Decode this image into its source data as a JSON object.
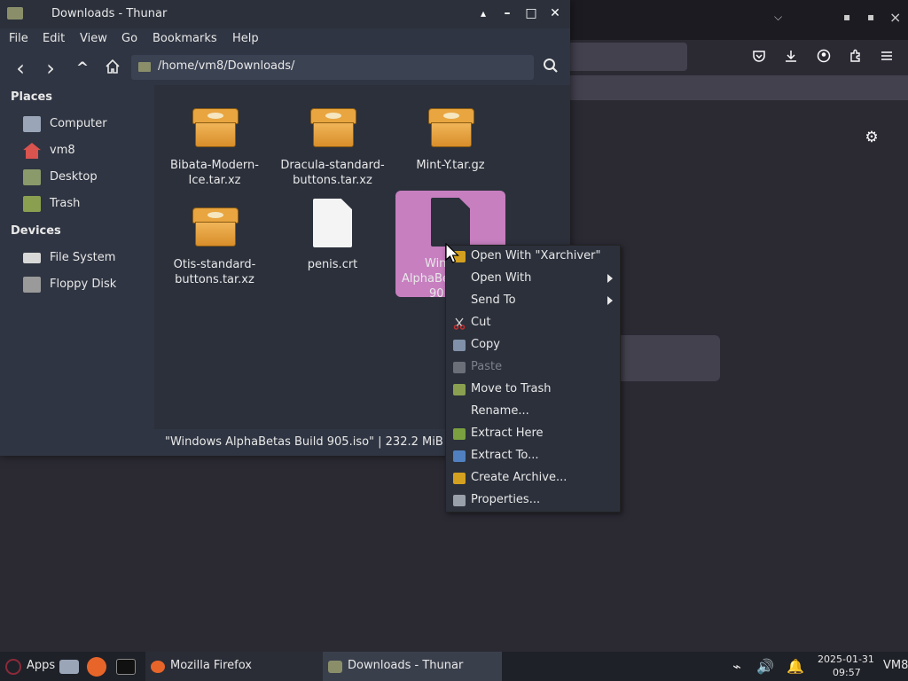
{
  "firefox": {
    "window_controls": {
      "chevron": "⌵",
      "minimize": "▪",
      "maximize": "▪",
      "close": "×"
    },
    "toolbar_icons": [
      "pocket-icon",
      "download-icon",
      "account-icon",
      "extensions-icon",
      "menu-icon"
    ],
    "gear": "⚙"
  },
  "thunar": {
    "title": "Downloads - Thunar",
    "window_controls": {
      "shade": "▴",
      "minimize": "–",
      "maximize": "□",
      "close": "✕"
    },
    "menu": [
      "File",
      "Edit",
      "View",
      "Go",
      "Bookmarks",
      "Help"
    ],
    "nav": {
      "back": "‹",
      "forward": "›",
      "up": "^",
      "home": "⌂"
    },
    "path": "/home/vm8/Downloads/",
    "search_glyph": "⌕",
    "sidebar": {
      "places_header": "Places",
      "places": [
        {
          "label": "Computer",
          "icon": "computer-icon",
          "color": "#9aa6b8"
        },
        {
          "label": "vm8",
          "icon": "home-icon",
          "color": "#d9534f"
        },
        {
          "label": "Desktop",
          "icon": "desktop-icon",
          "color": "#8a9a6a"
        },
        {
          "label": "Trash",
          "icon": "trash-icon",
          "color": "#8aa050"
        }
      ],
      "devices_header": "Devices",
      "devices": [
        {
          "label": "File System",
          "icon": "drive-icon",
          "color": "#d8d8d8"
        },
        {
          "label": "Floppy Disk",
          "icon": "floppy-icon",
          "color": "#9a9a9a"
        }
      ]
    },
    "files": [
      {
        "name_line1": "Bibata-Modern-",
        "name_line2": "Ice.tar.xz",
        "type": "archive"
      },
      {
        "name_line1": "Dracula-standard-",
        "name_line2": "buttons.tar.xz",
        "type": "archive"
      },
      {
        "name_line1": "Mint-Y.tar.gz",
        "name_line2": "",
        "type": "archive"
      },
      {
        "name_line1": "Otis-standard-",
        "name_line2": "buttons.tar.xz",
        "type": "archive"
      },
      {
        "name_line1": "penis.crt",
        "name_line2": "",
        "type": "document"
      },
      {
        "name_line1": "Win",
        "name_line2": "AlphaBe",
        "name_line3": "90",
        "type": "iso",
        "selected": true
      }
    ],
    "status": "\"Windows AlphaBetas Build 905.iso\"  |  232.2 MiB"
  },
  "context_menu": {
    "items": [
      {
        "label": "Open With \"Xarchiver\"",
        "icon": "xarchiver-icon",
        "color": "#d4a020"
      },
      {
        "label": "Open With",
        "submenu": true
      },
      {
        "label": "Send To",
        "submenu": true
      },
      {
        "label": "Cut",
        "icon": "cut-icon",
        "color": "#c03030"
      },
      {
        "label": "Copy",
        "icon": "copy-icon",
        "color": "#8090a8"
      },
      {
        "label": "Paste",
        "icon": "paste-icon",
        "color": "#6a6f78",
        "disabled": true
      },
      {
        "label": "Move to Trash",
        "icon": "trash-icon",
        "color": "#8aa050"
      },
      {
        "label": "Rename..."
      },
      {
        "label": "Extract Here",
        "icon": "extract-here-icon",
        "color": "#7aa040"
      },
      {
        "label": "Extract To...",
        "icon": "extract-to-icon",
        "color": "#5080c0"
      },
      {
        "label": "Create Archive...",
        "icon": "create-archive-icon",
        "color": "#d4a020"
      },
      {
        "label": "Properties...",
        "icon": "properties-icon",
        "color": "#9aa0aa"
      }
    ]
  },
  "taskbar": {
    "apps_label": "Apps",
    "tasks": [
      {
        "label": "Mozilla Firefox",
        "color": "#e8652a"
      },
      {
        "label": "Downloads - Thunar",
        "color": "#8a8f6a"
      }
    ],
    "tray": {
      "network": "⌁",
      "volume": "🔊",
      "notifications": "🔔"
    },
    "clock_date": "2025-01-31",
    "clock_time": "09:57",
    "vm_label": "VM8"
  }
}
